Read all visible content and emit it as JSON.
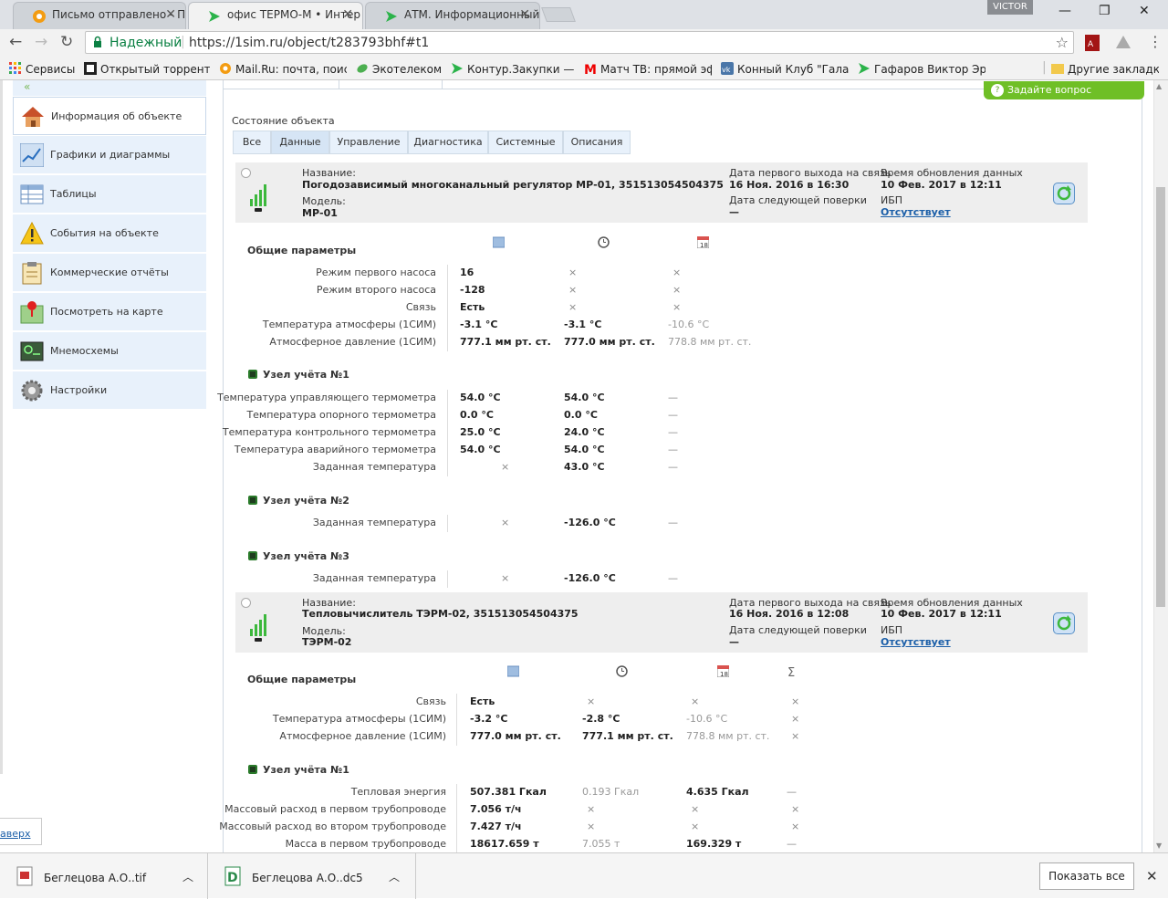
{
  "browser": {
    "tabs": [
      {
        "title": "Письмо отправлено - П"
      },
      {
        "title": "офис ТЕРМО-М • Интер"
      },
      {
        "title": "АТМ. Информационный"
      }
    ],
    "user": "VICTOR",
    "secure_label": "Надежный",
    "url": "https://1sim.ru/object/t283793bhf#t1",
    "bookmarks": [
      {
        "label": "Сервисы"
      },
      {
        "label": "Открытый торрент тр"
      },
      {
        "label": "Mail.Ru: почта, поиск"
      },
      {
        "label": "Экотелеком"
      },
      {
        "label": "Контур.Закупки — бе"
      },
      {
        "label": "Матч ТВ: прямой эфи"
      },
      {
        "label": "Конный Клуб \"Галакт"
      },
      {
        "label": "Гафаров Виктор Эрне"
      },
      {
        "label": "Другие закладки"
      }
    ]
  },
  "sidebar": {
    "items": [
      {
        "label": "Информация об объекте"
      },
      {
        "label": "Графики и диаграммы"
      },
      {
        "label": "Таблицы"
      },
      {
        "label": "События на объекте"
      },
      {
        "label": "Коммерческие отчёты"
      },
      {
        "label": "Посмотреть на карте"
      },
      {
        "label": "Мнемосхемы"
      },
      {
        "label": "Настройки"
      }
    ],
    "back_label": "аверх"
  },
  "ask_label": "Задайте вопрос специалисту",
  "state_title": "Состояние объекта",
  "filter_tabs": [
    "Все",
    "Данные",
    "Управление",
    "Диагностика",
    "Системные",
    "Описания"
  ],
  "devices": [
    {
      "name_label": "Название:",
      "name": "Погодозависимый многоканальный регулятор МР-01, 351513054504375",
      "model_label": "Модель:",
      "model": "МР-01",
      "first_label": "Дата первого выхода на связь",
      "first": "16 Ноя. 2016 в 16:30",
      "next_label": "Дата следующей поверки",
      "next": "—",
      "upd_label": "Время обновления данных",
      "upd": "10 Фев. 2017 в 12:11",
      "ibp_label": "ИБП",
      "ibp": "Отсутствует"
    },
    {
      "name_label": "Название:",
      "name": "Тепловычислитель ТЭРМ-02, 351513054504375",
      "model_label": "Модель:",
      "model": "ТЭРМ-02",
      "first_label": "Дата первого выхода на связь",
      "first": "16 Ноя. 2016 в 12:08",
      "next_label": "Дата следующей поверки",
      "next": "—",
      "upd_label": "Время обновления данных",
      "upd": "10 Фев. 2017 в 12:11",
      "ibp_label": "ИБП",
      "ibp": "Отсутствует"
    }
  ],
  "d1": {
    "general": "Общие параметры",
    "gen_rows": [
      {
        "label": "Режим первого насоса",
        "c1": "16",
        "c2": "×",
        "c3": "×"
      },
      {
        "label": "Режим второго насоса",
        "c1": "-128",
        "c2": "×",
        "c3": "×"
      },
      {
        "label": "Связь",
        "c1": "Есть",
        "c2": "×",
        "c3": "×"
      },
      {
        "label": "Температура атмосферы (1СИМ)",
        "c1": "-3.1 °C",
        "c2": "-3.1 °C",
        "c3": "-10.6 °C"
      },
      {
        "label": "Атмосферное давление (1СИМ)",
        "c1": "777.1 мм рт. ст.",
        "c2": "777.0 мм рт. ст.",
        "c3": "778.8 мм рт. ст."
      }
    ],
    "node1": "Узел учёта №1",
    "node1_rows": [
      {
        "label": "Температура управляющего термометра",
        "c1": "54.0 °C",
        "c2": "54.0 °C",
        "c3": "—"
      },
      {
        "label": "Температура опорного термометра",
        "c1": "0.0 °C",
        "c2": "0.0 °C",
        "c3": "—"
      },
      {
        "label": "Температура контрольного термометра",
        "c1": "25.0 °C",
        "c2": "24.0 °C",
        "c3": "—"
      },
      {
        "label": "Температура аварийного термометра",
        "c1": "54.0 °C",
        "c2": "54.0 °C",
        "c3": "—"
      },
      {
        "label": "Заданная температура",
        "c1": "×",
        "c2": "43.0 °C",
        "c3": "—"
      }
    ],
    "node2": "Узел учёта №2",
    "node2_rows": [
      {
        "label": "Заданная температура",
        "c1": "×",
        "c2": "-126.0 °C",
        "c3": "—"
      }
    ],
    "node3": "Узел учёта №3",
    "node3_rows": [
      {
        "label": "Заданная температура",
        "c1": "×",
        "c2": "-126.0 °C",
        "c3": "—"
      }
    ]
  },
  "d2": {
    "general": "Общие параметры",
    "gen_rows": [
      {
        "label": "Связь",
        "c1": "Есть",
        "c2": "×",
        "c3": "×",
        "c4": "×"
      },
      {
        "label": "Температура атмосферы (1СИМ)",
        "c1": "-3.2 °C",
        "c2": "-2.8 °C",
        "c3": "-10.6 °C",
        "c4": "×"
      },
      {
        "label": "Атмосферное давление (1СИМ)",
        "c1": "777.0 мм рт. ст.",
        "c2": "777.1 мм рт. ст.",
        "c3": "778.8 мм рт. ст.",
        "c4": "×"
      }
    ],
    "node1": "Узел учёта №1",
    "node1_rows": [
      {
        "label": "Тепловая энергия",
        "c1": "507.381 Гкал",
        "c2": "0.193 Гкал",
        "c3": "4.635 Гкал",
        "c4": "—"
      },
      {
        "label": "Массовый расход в первом трубопроводе",
        "c1": "7.056 т/ч",
        "c2": "×",
        "c3": "×",
        "c4": "×"
      },
      {
        "label": "Массовый расход во втором трубопроводе",
        "c1": "7.427 т/ч",
        "c2": "×",
        "c3": "×",
        "c4": "×"
      },
      {
        "label": "Масса в первом трубопроводе",
        "c1": "18617.659 т",
        "c2": "7.055 т",
        "c3": "169.329 т",
        "c4": "—"
      }
    ]
  },
  "downloads": [
    {
      "name": "Беглецова А.О..tif"
    },
    {
      "name": "Беглецова А.О..dc5"
    }
  ],
  "show_all": "Показать все"
}
